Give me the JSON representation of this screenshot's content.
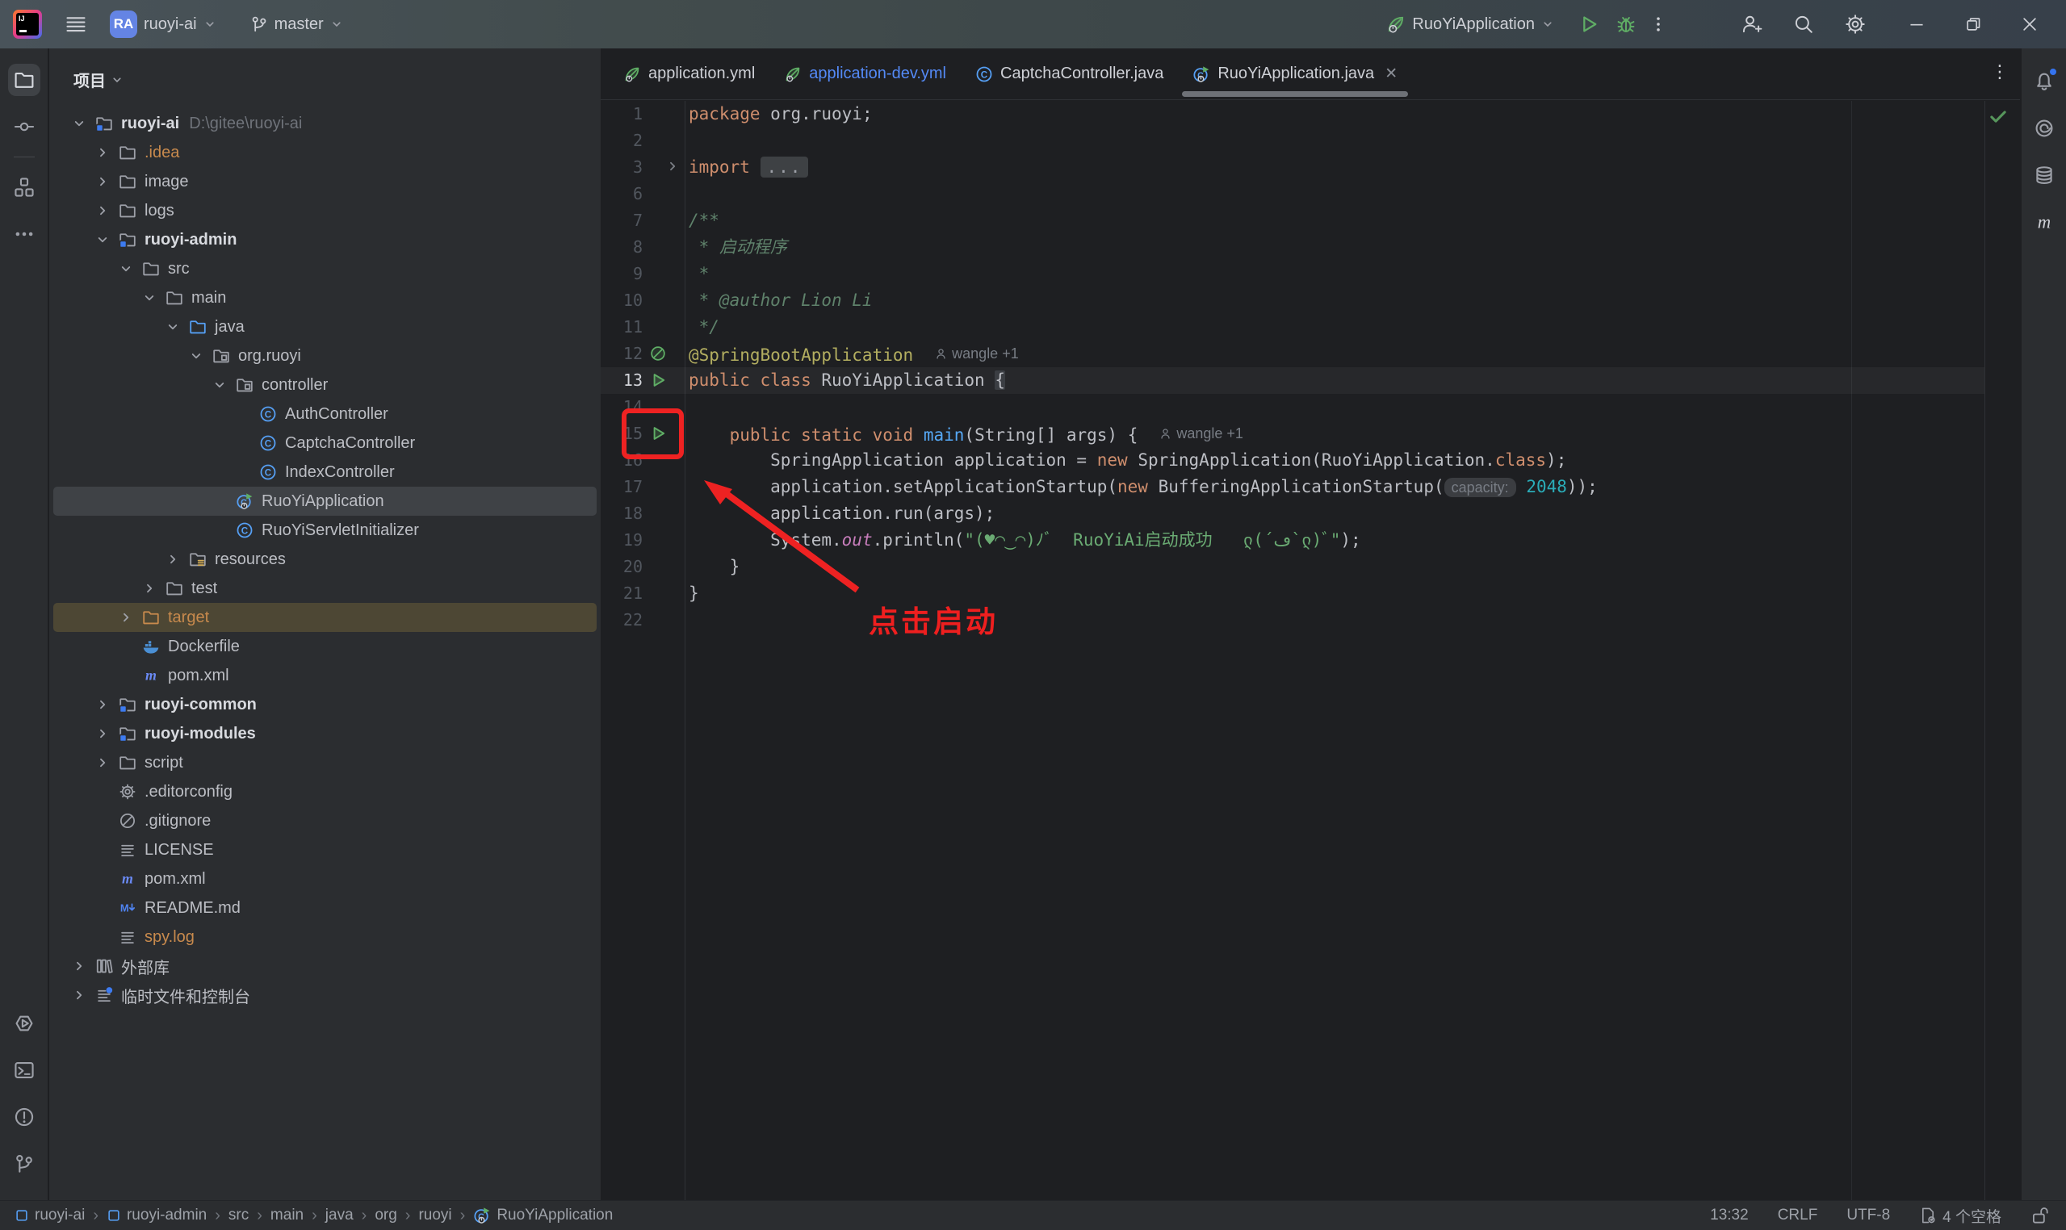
{
  "colors": {
    "accent_annotation_red": "#ee2222",
    "modified_file_blue": "#548af7",
    "excluded_orange": "#c88a4d",
    "run_green": "#5fad65",
    "selection_gray": "#3f4246",
    "target_row_brown": "#4d4734",
    "notification_badge_blue": "#3574f0"
  },
  "title_bar": {
    "logo": "intellij-idea-logo",
    "menu": "hamburger-menu",
    "project_avatar": "RA",
    "project_name": "ruoyi-ai",
    "branch_name": "master",
    "run_config_name": "RuoYiApplication",
    "actions": [
      "run",
      "debug",
      "more"
    ],
    "right_icons": [
      "add-user",
      "search",
      "settings",
      "minimize",
      "maximize",
      "close"
    ]
  },
  "tool_stripe_left": {
    "top": [
      {
        "name": "project",
        "icon": "folder-tool",
        "active": true
      },
      {
        "name": "commit",
        "icon": "commit"
      },
      {
        "divider": true
      },
      {
        "name": "structure",
        "icon": "structure"
      },
      {
        "name": "more-tools",
        "icon": "dots"
      }
    ],
    "bottom": [
      {
        "name": "run-tool",
        "icon": "hex-play"
      },
      {
        "name": "terminal",
        "icon": "terminal"
      },
      {
        "name": "problems",
        "icon": "problems"
      },
      {
        "name": "version-control",
        "icon": "git-branch"
      }
    ]
  },
  "tool_stripe_right": [
    {
      "name": "notifications",
      "icon": "bell",
      "badge": true
    },
    {
      "name": "ai-assistant",
      "icon": "ai"
    },
    {
      "name": "database",
      "icon": "db"
    },
    {
      "name": "maven",
      "icon": "maven-gray"
    }
  ],
  "project_panel": {
    "header": "项目",
    "tree": [
      {
        "level": 0,
        "chev": "down",
        "icon": "module-folder",
        "label": "ruoyi-ai",
        "bold": true,
        "extra": "D:\\gitee\\ruoyi-ai"
      },
      {
        "level": 1,
        "chev": "right",
        "icon": "folder",
        "label": ".idea",
        "excluded": true
      },
      {
        "level": 1,
        "chev": "right",
        "icon": "folder",
        "label": "image"
      },
      {
        "level": 1,
        "chev": "right",
        "icon": "folder",
        "label": "logs"
      },
      {
        "level": 1,
        "chev": "down",
        "icon": "module-folder",
        "label": "ruoyi-admin",
        "bold": true
      },
      {
        "level": 2,
        "chev": "down",
        "icon": "folder",
        "label": "src"
      },
      {
        "level": 3,
        "chev": "down",
        "icon": "folder",
        "label": "main"
      },
      {
        "level": 4,
        "chev": "down",
        "icon": "folder-blue",
        "label": "java"
      },
      {
        "level": 5,
        "chev": "down",
        "icon": "package",
        "label": "org.ruoyi"
      },
      {
        "level": 6,
        "chev": "down",
        "icon": "package",
        "label": "controller"
      },
      {
        "level": 7,
        "chev": "none",
        "icon": "class",
        "label": "AuthController"
      },
      {
        "level": 7,
        "chev": "none",
        "icon": "class",
        "label": "CaptchaController"
      },
      {
        "level": 7,
        "chev": "none",
        "icon": "class",
        "label": "IndexController"
      },
      {
        "level": 6,
        "chev": "none",
        "icon": "springboot-class",
        "label": "RuoYiApplication",
        "selected": true
      },
      {
        "level": 6,
        "chev": "none",
        "icon": "class",
        "label": "RuoYiServletInitializer"
      },
      {
        "level": 4,
        "chev": "right",
        "icon": "resources",
        "label": "resources"
      },
      {
        "level": 3,
        "chev": "right",
        "icon": "folder",
        "label": "test"
      },
      {
        "level": 2,
        "chev": "right",
        "icon": "folder-orange",
        "label": "target",
        "excluded": true,
        "warnrow": true
      },
      {
        "level": 2,
        "chev": "none",
        "icon": "docker",
        "label": "Dockerfile"
      },
      {
        "level": 2,
        "chev": "none",
        "icon": "maven",
        "label": "pom.xml"
      },
      {
        "level": 1,
        "chev": "right",
        "icon": "module-folder",
        "label": "ruoyi-common",
        "bold": true
      },
      {
        "level": 1,
        "chev": "right",
        "icon": "module-folder",
        "label": "ruoyi-modules",
        "bold": true
      },
      {
        "level": 1,
        "chev": "right",
        "icon": "folder",
        "label": "script"
      },
      {
        "level": 1,
        "chev": "none",
        "icon": "gear",
        "label": ".editorconfig"
      },
      {
        "level": 1,
        "chev": "none",
        "icon": "no-entry",
        "label": ".gitignore"
      },
      {
        "level": 1,
        "chev": "none",
        "icon": "text-file",
        "label": "LICENSE"
      },
      {
        "level": 1,
        "chev": "none",
        "icon": "maven",
        "label": "pom.xml"
      },
      {
        "level": 1,
        "chev": "none",
        "icon": "markdown",
        "label": "README.md"
      },
      {
        "level": 1,
        "chev": "none",
        "icon": "text-file",
        "label": "spy.log",
        "excluded": true
      },
      {
        "level": 0,
        "chev": "right",
        "icon": "ext-lib",
        "label": "外部库"
      },
      {
        "level": 0,
        "chev": "right",
        "icon": "scratches",
        "label": "临时文件和控制台"
      }
    ]
  },
  "editor": {
    "tabs": [
      {
        "icon": "spring-leaf",
        "label": "application.yml"
      },
      {
        "icon": "spring-leaf",
        "label": "application-dev.yml",
        "modified": true
      },
      {
        "icon": "class",
        "label": "CaptchaController.java"
      },
      {
        "icon": "springboot-class",
        "label": "RuoYiApplication.java",
        "active": true,
        "close": "✕"
      }
    ],
    "tab_more": "⋮",
    "inspection_status": "no-problems-check",
    "code_lines": [
      {
        "n": "1",
        "tokens": [
          [
            "k",
            "package"
          ],
          [
            "t",
            " org.ruoyi;"
          ]
        ]
      },
      {
        "n": "2",
        "tokens": []
      },
      {
        "n": "3",
        "fold": true,
        "tokens": [
          [
            "k",
            "import"
          ],
          [
            "t",
            " "
          ],
          [
            "fold",
            "..."
          ]
        ]
      },
      {
        "n": "6",
        "tokens": []
      },
      {
        "n": "7",
        "tokens": [
          [
            "doc",
            "/**"
          ]
        ]
      },
      {
        "n": "8",
        "tokens": [
          [
            "doc",
            " * 启动程序"
          ]
        ]
      },
      {
        "n": "9",
        "tokens": [
          [
            "doc",
            " *"
          ]
        ]
      },
      {
        "n": "10",
        "tokens": [
          [
            "doc",
            " * @author Lion Li"
          ]
        ]
      },
      {
        "n": "11",
        "tokens": [
          [
            "doc",
            " */"
          ]
        ]
      },
      {
        "n": "12",
        "gutter": "spring-bean",
        "hint": "wangle +1",
        "tokens": [
          [
            "ann",
            "@SpringBootApplication"
          ]
        ]
      },
      {
        "n": "13",
        "gutter": "run",
        "current": true,
        "tokens": [
          [
            "k",
            "public"
          ],
          [
            "t",
            " "
          ],
          [
            "k",
            "class"
          ],
          [
            "t",
            " RuoYiApplication "
          ],
          [
            "brace",
            "{"
          ]
        ]
      },
      {
        "n": "14",
        "tokens": []
      },
      {
        "n": "15",
        "gutter": "run",
        "hint": "wangle +1",
        "tokens": [
          [
            "t",
            "    "
          ],
          [
            "k",
            "public"
          ],
          [
            "t",
            " "
          ],
          [
            "k",
            "static"
          ],
          [
            "t",
            " "
          ],
          [
            "k",
            "void"
          ],
          [
            "t",
            " "
          ],
          [
            "m",
            "main"
          ],
          [
            "t",
            "(String[] args) {"
          ]
        ]
      },
      {
        "n": "16",
        "tokens": [
          [
            "t",
            "        SpringApplication application = "
          ],
          [
            "k",
            "new"
          ],
          [
            "t",
            " SpringApplication(RuoYiApplication."
          ],
          [
            "k",
            "class"
          ],
          [
            "t",
            ");"
          ]
        ]
      },
      {
        "n": "17",
        "tokens": [
          [
            "t",
            "        application.setApplicationStartup("
          ],
          [
            "k",
            "new"
          ],
          [
            "t",
            " BufferingApplicationStartup("
          ],
          [
            "ihint",
            "capacity:"
          ],
          [
            "t",
            " "
          ],
          [
            "n2",
            "2048"
          ],
          [
            "t",
            "));"
          ]
        ]
      },
      {
        "n": "18",
        "tokens": [
          [
            "t",
            "        application.run(args);"
          ]
        ]
      },
      {
        "n": "19",
        "tokens": [
          [
            "t",
            "        System."
          ],
          [
            "fld",
            "out"
          ],
          [
            "t",
            ".println("
          ],
          [
            "s",
            "\"(♥◠‿◠)ﾉﾞ  RuoYiAi启动成功   ლ(´ڡ`ლ)ﾞ\""
          ],
          [
            "t",
            ");"
          ]
        ]
      },
      {
        "n": "20",
        "tokens": [
          [
            "t",
            "    }"
          ]
        ]
      },
      {
        "n": "21",
        "tokens": [
          [
            "t",
            "}"
          ]
        ]
      },
      {
        "n": "22",
        "tokens": []
      }
    ]
  },
  "annotations": {
    "label": "点击启动",
    "box_target": "run-gutter-icon-line-15",
    "arrow": "points-to-run-icon"
  },
  "status_bar": {
    "breadcrumbs": [
      {
        "icon": "module-square",
        "label": "ruoyi-ai"
      },
      {
        "icon": "module-square",
        "label": "ruoyi-admin"
      },
      {
        "label": "src"
      },
      {
        "label": "main"
      },
      {
        "label": "java"
      },
      {
        "label": "org"
      },
      {
        "label": "ruoyi"
      },
      {
        "icon": "springboot-class",
        "label": "RuoYiApplication"
      }
    ],
    "separator": "›",
    "right_items": [
      {
        "name": "clock",
        "label": "13:32"
      },
      {
        "name": "line-ending",
        "label": "CRLF"
      },
      {
        "name": "encoding",
        "label": "UTF-8"
      },
      {
        "name": "indent",
        "icon": "file-gear",
        "label": "4 个空格"
      },
      {
        "name": "readonly-toggle",
        "icon": "unlock",
        "label": ""
      }
    ]
  }
}
